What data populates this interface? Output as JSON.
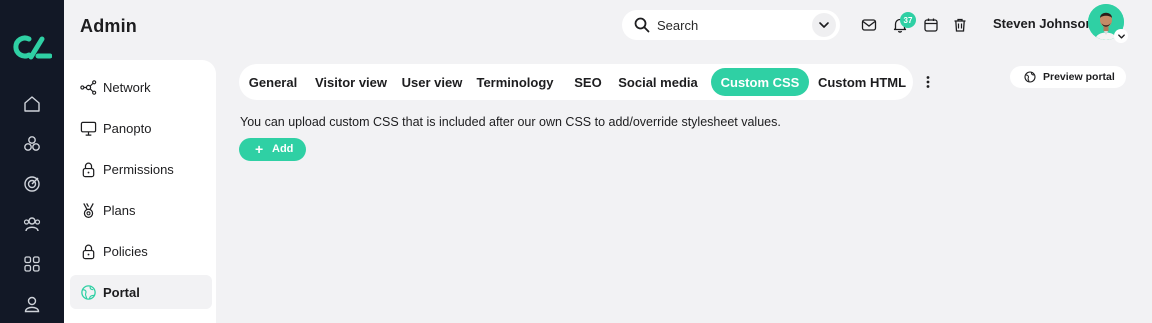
{
  "header": {
    "title": "Admin",
    "search_placeholder": "Search",
    "notification_count": "37",
    "user_name": "Steven Johnson"
  },
  "rail": {
    "icons": [
      "logo-icon",
      "home-icon",
      "modules-icon",
      "target-icon",
      "users-icon",
      "apps-icon",
      "profile-icon"
    ]
  },
  "sidebar": {
    "items": [
      {
        "label": "Network",
        "icon": "network-icon",
        "active": false
      },
      {
        "label": "Panopto",
        "icon": "monitor-icon",
        "active": false
      },
      {
        "label": "Permissions",
        "icon": "lock-icon",
        "active": false
      },
      {
        "label": "Plans",
        "icon": "medal-icon",
        "active": false
      },
      {
        "label": "Policies",
        "icon": "lock-icon",
        "active": false
      },
      {
        "label": "Portal",
        "icon": "globe-icon",
        "active": true
      }
    ]
  },
  "tabs": [
    {
      "label": "General",
      "active": false
    },
    {
      "label": "Visitor view",
      "active": false
    },
    {
      "label": "User view",
      "active": false
    },
    {
      "label": "Terminology",
      "active": false
    },
    {
      "label": "SEO",
      "active": false
    },
    {
      "label": "Social media",
      "active": false
    },
    {
      "label": "Custom CSS",
      "active": true
    },
    {
      "label": "Custom HTML",
      "active": false
    }
  ],
  "preview_label": "Preview portal",
  "content": {
    "description": "You can upload custom CSS that is included after our own CSS to add/override stylesheet values.",
    "add_label": "Add"
  },
  "colors": {
    "accent": "#2fd0a4",
    "rail": "#121826",
    "background": "#f2f2f4"
  }
}
